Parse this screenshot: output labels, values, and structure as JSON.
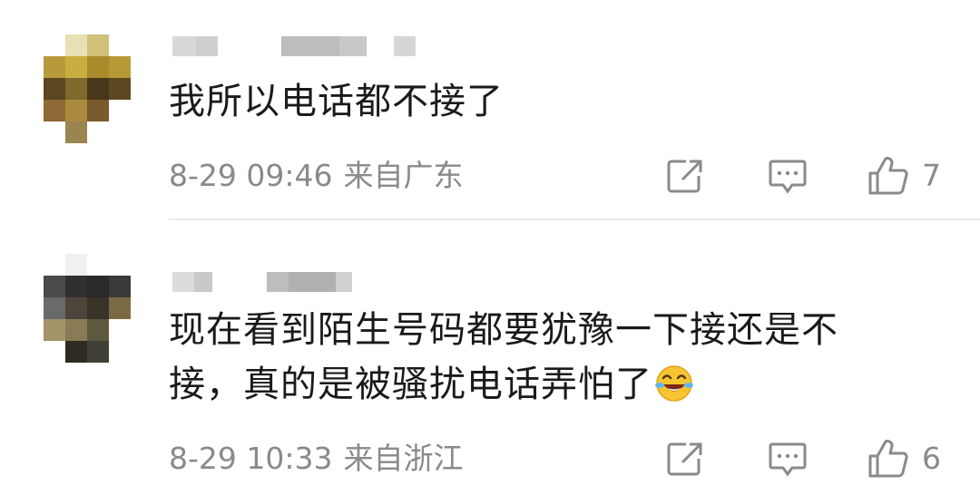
{
  "comments": [
    {
      "text_lines": [
        "我所以电话都不接了"
      ],
      "date": "8-29 09:46",
      "location": "来自广东",
      "likes": "7",
      "avatar_colors": [
        "#ffffff",
        "#e9e0b4",
        "#cfc07a",
        "#ffffff",
        "#b89a3c",
        "#c9ad3f",
        "#a98b2c",
        "#b79a36",
        "#5a4620",
        "#7d6a2c",
        "#4a361a",
        "#5b4822",
        "#8e6a36",
        "#a98a3e",
        "#7a5b2c",
        "#ffffff",
        "#ffffff",
        "#9a8450",
        "#ffffff",
        "#ffffff"
      ],
      "name_blur_colors": [
        "#d8d8d8",
        "#cfcfcf",
        "#bdbdbd",
        "#c8c8c8",
        "#d6d6d6"
      ]
    },
    {
      "text_lines": [
        "现在看到陌生号码都要犹豫一下接还是不",
        "接，真的是被骚扰电话弄怕了"
      ],
      "emoji": "laughing-crying-emoji",
      "date": "8-29 10:33",
      "location": "来自浙江",
      "likes": "6",
      "avatar_colors": [
        "#ffffff",
        "#f0f0f0",
        "#ffffff",
        "#ffffff",
        "#4a4a4a",
        "#303030",
        "#2a2a2a",
        "#3a3a3a",
        "#6a6a6a",
        "#4c4539",
        "#3a3428",
        "#7c6a44",
        "#a49268",
        "#8a7a55",
        "#5d5a3f",
        "#ffffff",
        "#ffffff",
        "#2f2a22",
        "#404036",
        "#ffffff"
      ],
      "name_blur_colors": [
        "#dcdcdc",
        "#c9c9c9",
        "#bdbdbd",
        "#b0b0b0",
        "#d0d0d0"
      ]
    }
  ],
  "icons": {
    "share": "share-icon",
    "reply": "comment-icon",
    "like": "thumbs-up-icon"
  }
}
